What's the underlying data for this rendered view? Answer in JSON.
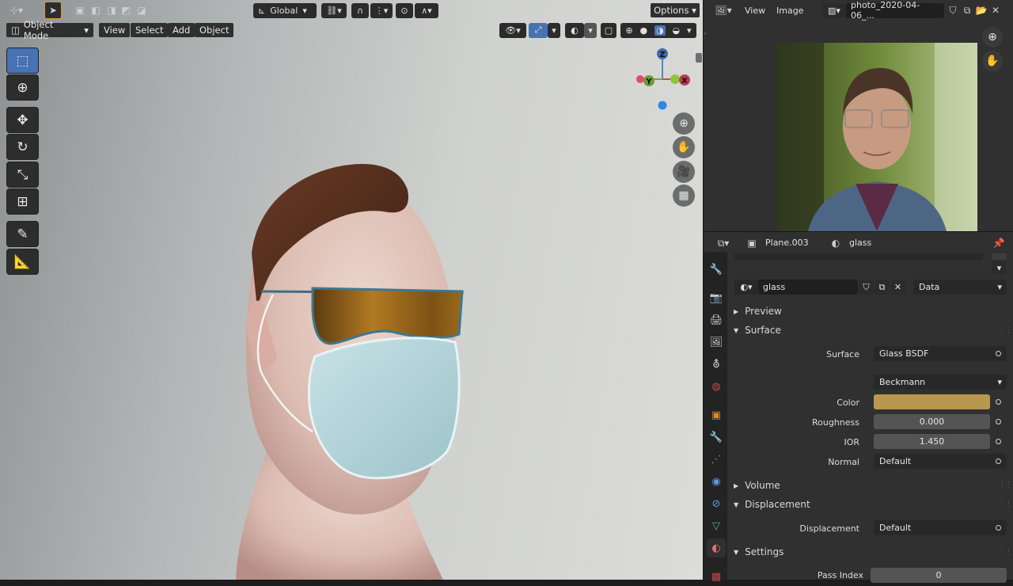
{
  "viewport": {
    "header": {
      "transform_orientation": "Global",
      "options_label": "Options",
      "mode": "Object Mode",
      "menus": [
        "View",
        "Select",
        "Add",
        "Object"
      ]
    },
    "gizmo": {
      "z": "Z",
      "y": "Y",
      "x": "X"
    },
    "tools": [
      "select-box",
      "cursor",
      "move",
      "rotate",
      "scale",
      "transform",
      "annotate",
      "measure"
    ]
  },
  "image_editor": {
    "menus": [
      "View",
      "Image"
    ],
    "image_name": "photo_2020-04-06_..."
  },
  "properties": {
    "breadcrumb": {
      "object": "Plane.003",
      "material": "glass"
    },
    "material_name": "glass",
    "link_mode": "Data",
    "panels": {
      "preview": "Preview",
      "surface": "Surface",
      "volume": "Volume",
      "displacement": "Displacement",
      "settings": "Settings"
    },
    "surface": {
      "surface_label": "Surface",
      "surface_value": "Glass BSDF",
      "distribution": "Beckmann",
      "color_label": "Color",
      "color_value": "#b8974e",
      "roughness_label": "Roughness",
      "roughness_value": "0.000",
      "ior_label": "IOR",
      "ior_value": "1.450",
      "normal_label": "Normal",
      "normal_value": "Default"
    },
    "displacement": {
      "label": "Displacement",
      "value": "Default"
    },
    "settings": {
      "pass_index_label": "Pass Index",
      "pass_index_value": "0"
    }
  }
}
